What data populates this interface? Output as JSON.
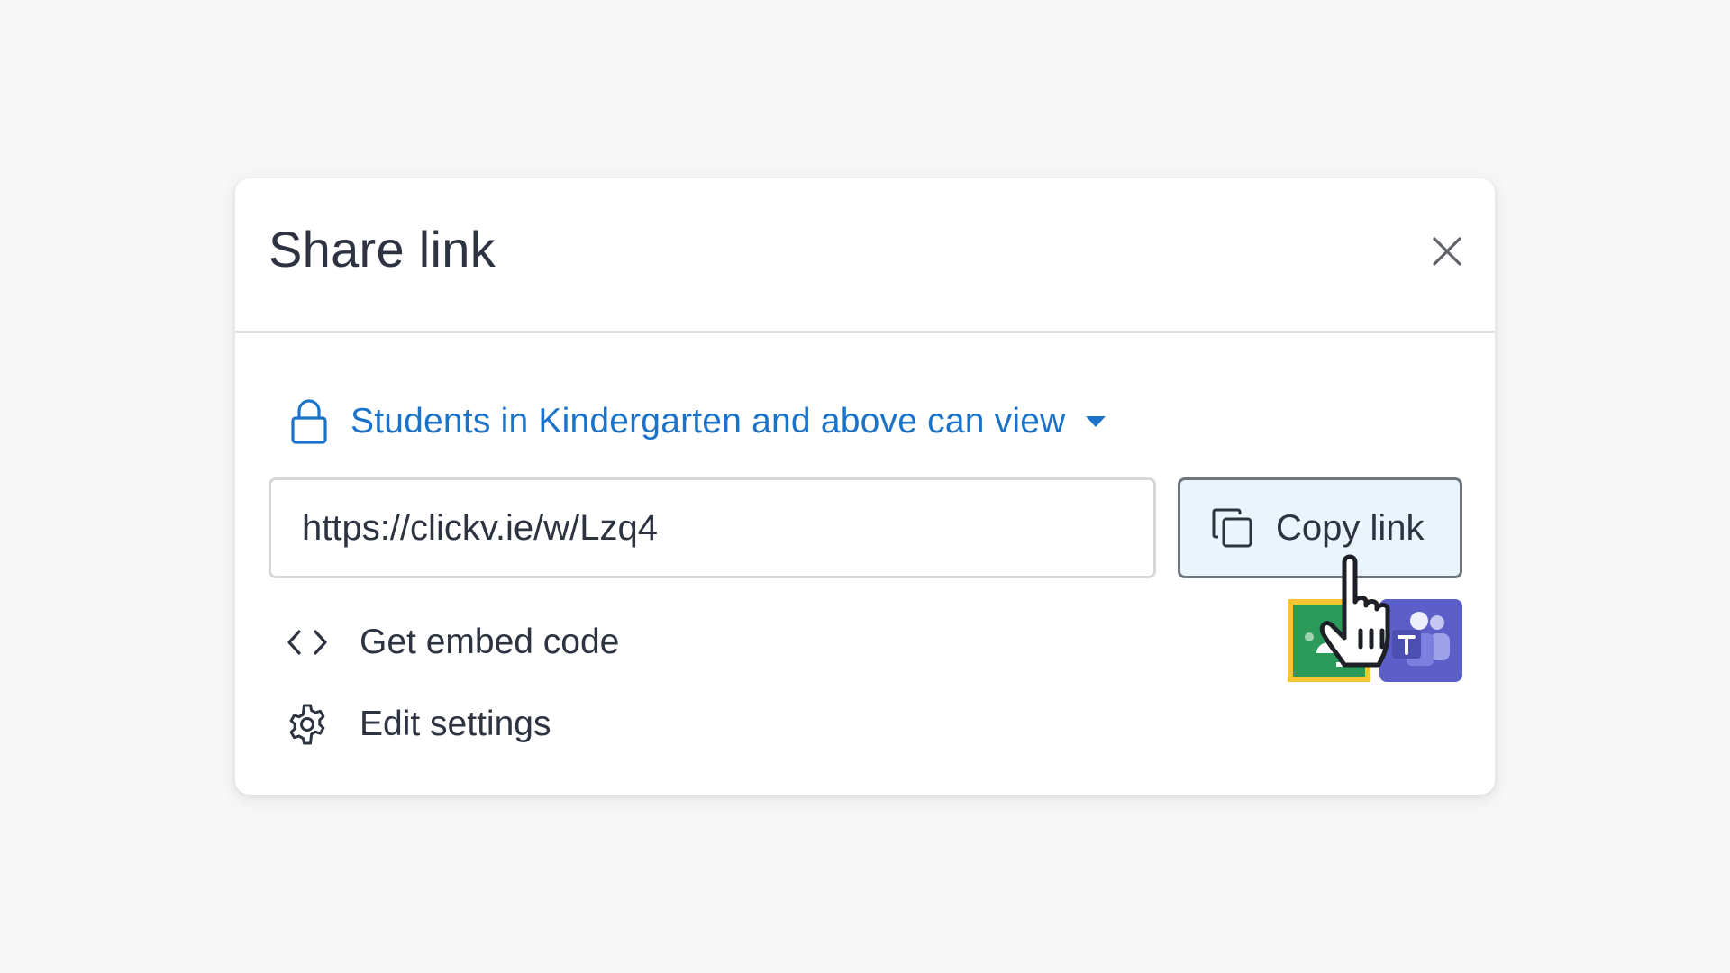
{
  "dialog": {
    "title": "Share link"
  },
  "visibility": {
    "label": "Students in Kindergarten and above can view",
    "icon": "lock-icon"
  },
  "link": {
    "url": "https://clickv.ie/w/Lzq4",
    "copy_label": "Copy link"
  },
  "actions": {
    "embed_label": "Get embed code",
    "settings_label": "Edit settings"
  },
  "integrations": [
    {
      "name": "google-classroom",
      "icon": "google-classroom-icon"
    },
    {
      "name": "microsoft-teams",
      "icon": "microsoft-teams-icon"
    }
  ],
  "colors": {
    "accent": "#1a73c9",
    "copy_button_bg": "#eaf4fc",
    "teams": "#5b5fc7",
    "classroom_green": "#2c9a5b",
    "classroom_yellow": "#f7c531"
  }
}
